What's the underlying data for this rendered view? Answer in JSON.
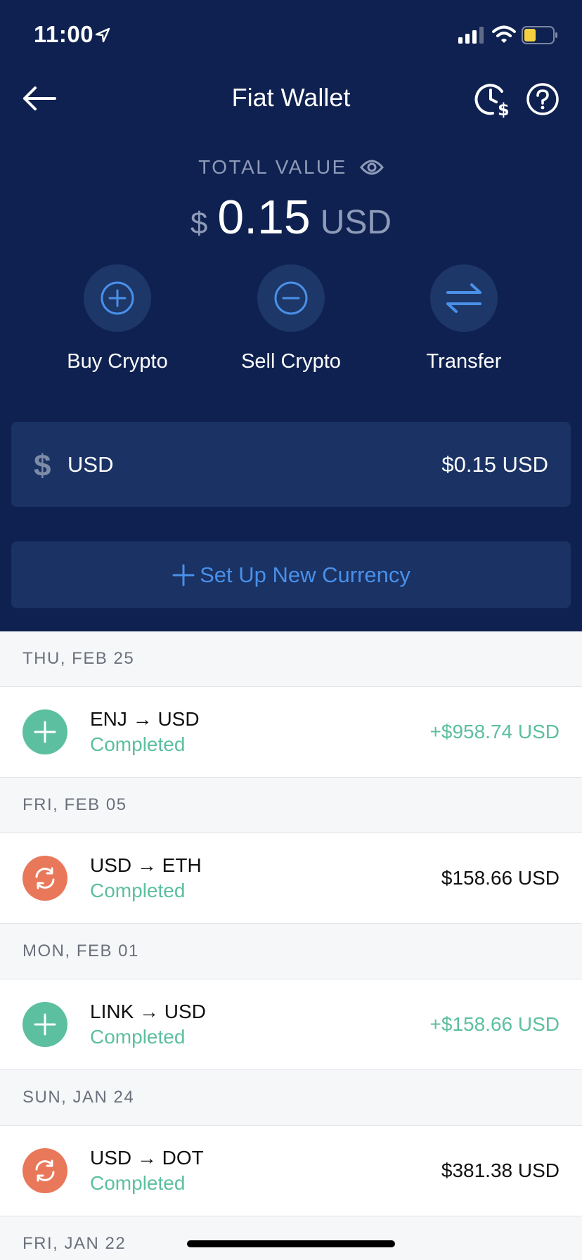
{
  "status_bar": {
    "time": "11:00",
    "battery_color": "#f4d03f"
  },
  "header": {
    "title": "Fiat Wallet"
  },
  "summary": {
    "label": "TOTAL VALUE",
    "currency_symbol": "$",
    "amount": "0.15",
    "unit": "USD"
  },
  "actions": [
    {
      "label": "Buy Crypto",
      "icon": "plus-circle-icon"
    },
    {
      "label": "Sell Crypto",
      "icon": "minus-circle-icon"
    },
    {
      "label": "Transfer",
      "icon": "transfer-arrows-icon"
    }
  ],
  "usd_card": {
    "symbol": "$",
    "label": "USD",
    "balance": "$0.15 USD"
  },
  "new_currency": {
    "label": "Set Up New Currency"
  },
  "transactions": [
    {
      "date": "THU, FEB 25",
      "pair": "ENJ → USD",
      "status": "Completed",
      "amount": "+$958.74 USD",
      "type": "deposit"
    },
    {
      "date": "FRI, FEB 05",
      "pair": "USD → ETH",
      "status": "Completed",
      "amount": "$158.66 USD",
      "type": "swap"
    },
    {
      "date": "MON, FEB 01",
      "pair": "LINK → USD",
      "status": "Completed",
      "amount": "+$158.66 USD",
      "type": "deposit"
    },
    {
      "date": "SUN, JAN 24",
      "pair": "USD → DOT",
      "status": "Completed",
      "amount": "$381.38 USD",
      "type": "swap"
    }
  ],
  "next_date": "FRI, JAN 22",
  "colors": {
    "header_bg": "#0f2150",
    "card_bg": "#1a3264",
    "accent_blue": "#4a90e8",
    "positive_green": "#5cbfa0",
    "swap_orange": "#e9785a"
  }
}
